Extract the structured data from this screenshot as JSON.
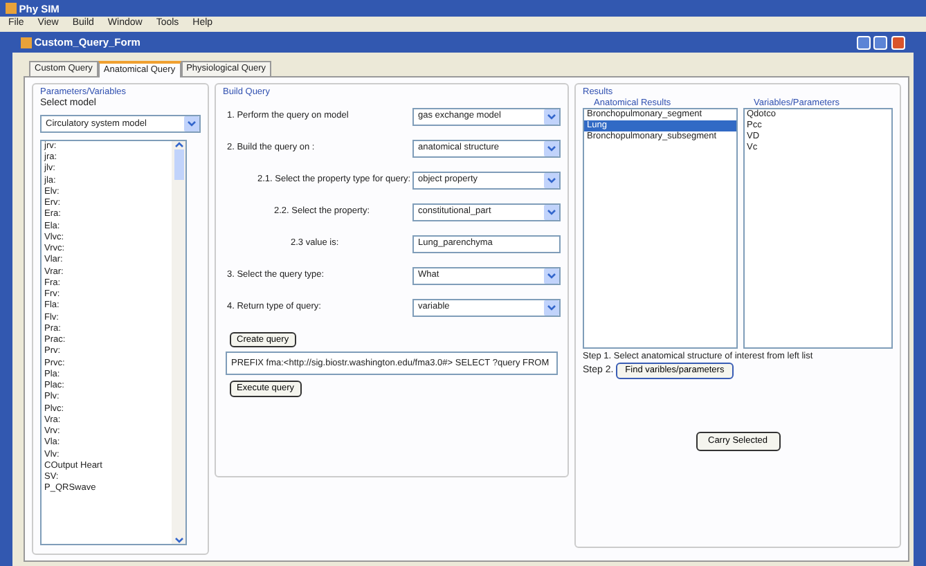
{
  "app_window": {
    "title": "Phy SIM"
  },
  "menu": [
    "File",
    "View",
    "Build",
    "Window",
    "Tools",
    "Help"
  ],
  "form_window": {
    "title": "Custom_Query_Form"
  },
  "tabs": [
    {
      "label": "Custom Query",
      "selected": false
    },
    {
      "label": "Anatomical Query",
      "selected": true
    },
    {
      "label": "Physiological Query",
      "selected": false
    }
  ],
  "parameters_group": {
    "title": "Parameters/Variables",
    "select_model_label": "Select model",
    "model": "Circulatory system model",
    "variables": [
      "jrv:",
      "jra:",
      "jlv:",
      "jla:",
      "Elv:",
      "Erv:",
      "Era:",
      "Ela:",
      "Vlvc:",
      "Vrvc:",
      "Vlar:",
      "Vrar:",
      "Fra:",
      "Frv:",
      "Fla:",
      "Flv:",
      "Pra:",
      "Prac:",
      "Prv:",
      "Prvc:",
      "Pla:",
      "Plac:",
      "Plv:",
      "Plvc:",
      "Vra:",
      "Vrv:",
      "Vla:",
      "Vlv:",
      "COutput Heart",
      "SV:",
      "P_QRSwave"
    ]
  },
  "build_query": {
    "title": "Build Query",
    "steps": [
      {
        "kind": "select",
        "label": "1. Perform the query on model",
        "value": "gas exchange model"
      },
      {
        "kind": "select",
        "label": "2. Build the query on :",
        "value": "anatomical structure",
        "children": [
          {
            "kind": "select",
            "label": "2.1. Select the property type for query:",
            "value": "object property",
            "children": [
              {
                "kind": "select",
                "label": "2.2. Select the property:",
                "value": "constitutional_part",
                "children": [
                  {
                    "kind": "text",
                    "label": "2.3 value is:",
                    "value": "Lung_parenchyma"
                  }
                ]
              }
            ]
          }
        ]
      },
      {
        "kind": "select",
        "label": "3. Select the query type:",
        "value": "What"
      },
      {
        "kind": "select",
        "label": "4. Return type of query:",
        "value": "variable"
      }
    ],
    "create_button": "Create query",
    "query_text": "PREFIX fma:<http://sig.biostr.washington.edu/fma3.0#> SELECT ?query FROM",
    "execute_button": "Execute query"
  },
  "results": {
    "title": "Results",
    "anatomical_results": {
      "title": "Anatomical Results",
      "items": [
        {
          "text": "Bronchopulmonary_segment",
          "selected": false
        },
        {
          "text": "Lung",
          "selected": true
        },
        {
          "text": "Bronchopulmonary_subsegment",
          "selected": false
        }
      ]
    },
    "variables_parameters": {
      "title": "Variables/Parameters",
      "items": [
        "Qdotco",
        "Pcc",
        "VD",
        "Vc"
      ]
    },
    "step1": "Step 1. Select anatomical structure of interest from left list",
    "step2_label": "Step 2.",
    "find_button": "Find varibles/parameters",
    "carry_button": "Carry Selected"
  }
}
